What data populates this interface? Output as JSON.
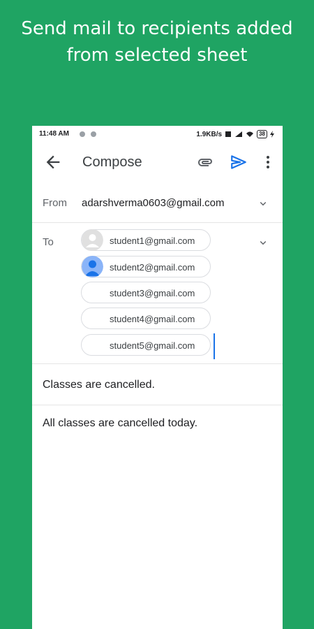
{
  "headline": {
    "line1": "Send mail to recipients added",
    "line2": "from selected sheet"
  },
  "status_bar": {
    "time": "11:48 AM",
    "speed": "1.9KB/s",
    "battery": "38"
  },
  "app_bar": {
    "title": "Compose",
    "icons": [
      "back-arrow-icon",
      "attach-icon",
      "send-icon",
      "more-vert-icon"
    ],
    "accent_color": "#1a73e8"
  },
  "from": {
    "label": "From",
    "value": "adarshverma0603@gmail.com"
  },
  "to": {
    "label": "To",
    "recipients": [
      "student1@gmail.com",
      "student2@gmail.com",
      "student3@gmail.com",
      "student4@gmail.com",
      "student5@gmail.com"
    ]
  },
  "subject": "Classes are cancelled.",
  "body": "All classes are cancelled today.",
  "colors": {
    "background": "#1fa463",
    "send_icon": "#1a73e8"
  }
}
